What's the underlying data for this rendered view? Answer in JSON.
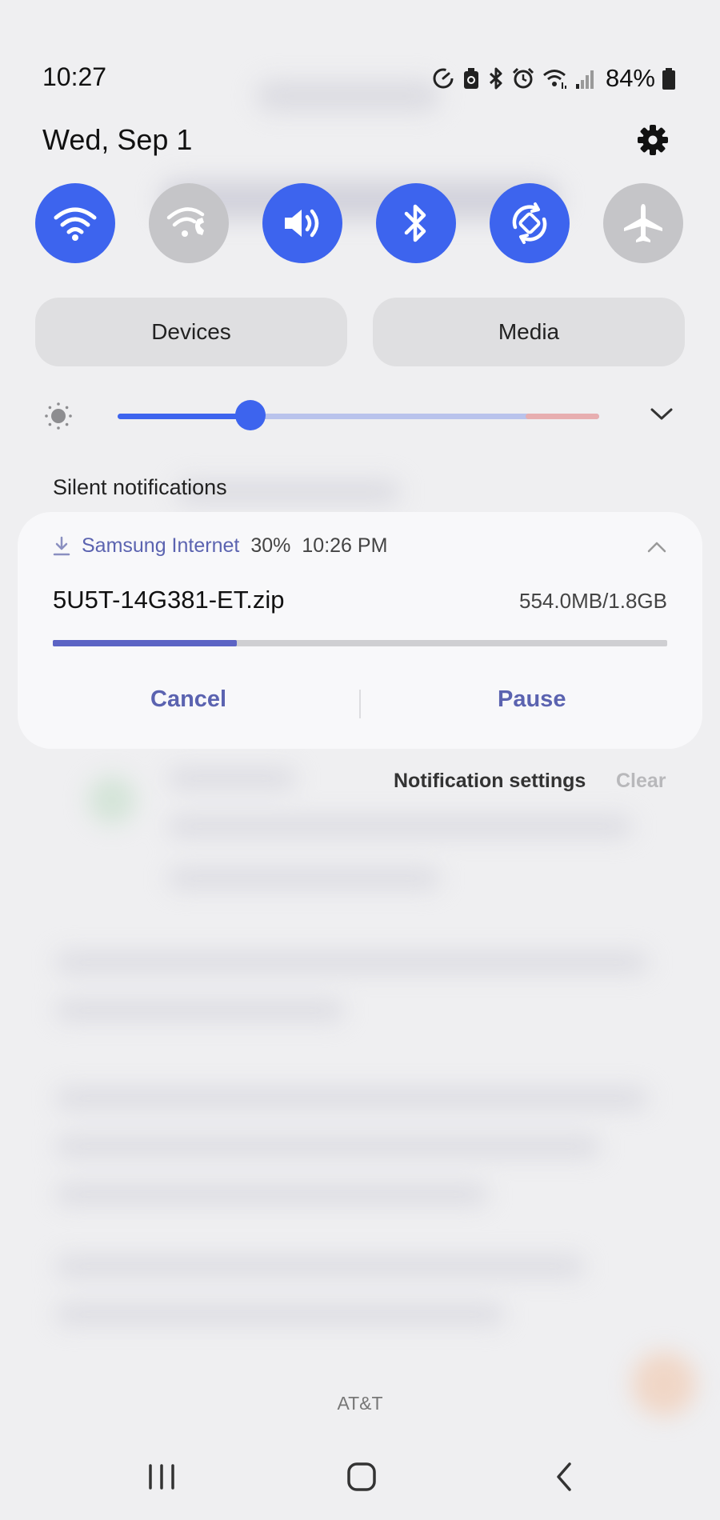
{
  "status_bar": {
    "time": "10:27",
    "battery": "84%",
    "icons": [
      "data-saver-icon",
      "battery-saver-icon",
      "bluetooth-icon",
      "alarm-icon",
      "wifi-calling-icon",
      "signal-icon",
      "battery-icon"
    ]
  },
  "header": {
    "date": "Wed, Sep 1",
    "settings_icon": "gear-icon"
  },
  "quick_settings": [
    {
      "name": "wifi",
      "icon": "wifi-icon",
      "on": true
    },
    {
      "name": "wifi-calling",
      "icon": "wifi-calling-icon",
      "on": false
    },
    {
      "name": "sound",
      "icon": "speaker-icon",
      "on": true
    },
    {
      "name": "bluetooth",
      "icon": "bluetooth-icon",
      "on": true
    },
    {
      "name": "auto-rotate",
      "icon": "auto-rotate-icon",
      "on": true
    },
    {
      "name": "airplane-mode",
      "icon": "airplane-icon",
      "on": false
    }
  ],
  "pills": {
    "devices": "Devices",
    "media": "Media"
  },
  "brightness": {
    "level": 0.275
  },
  "colors": {
    "accent": "#3d64ee",
    "inactive": "#c5c5c8",
    "notif_accent": "#5b63b0",
    "background": "#efeff1"
  },
  "silent_label": "Silent notifications",
  "notification": {
    "app": "Samsung Internet",
    "percent": "30%",
    "time": "10:26 PM",
    "filename": "5U5T-14G381-ET.zip",
    "size": "554.0MB/1.8GB",
    "progress": 0.3,
    "cancel": "Cancel",
    "pause": "Pause"
  },
  "footer_actions": {
    "settings": "Notification settings",
    "clear": "Clear"
  },
  "carrier": "AT&T",
  "nav": {
    "icons": [
      "recents-icon",
      "home-icon",
      "back-icon"
    ]
  }
}
